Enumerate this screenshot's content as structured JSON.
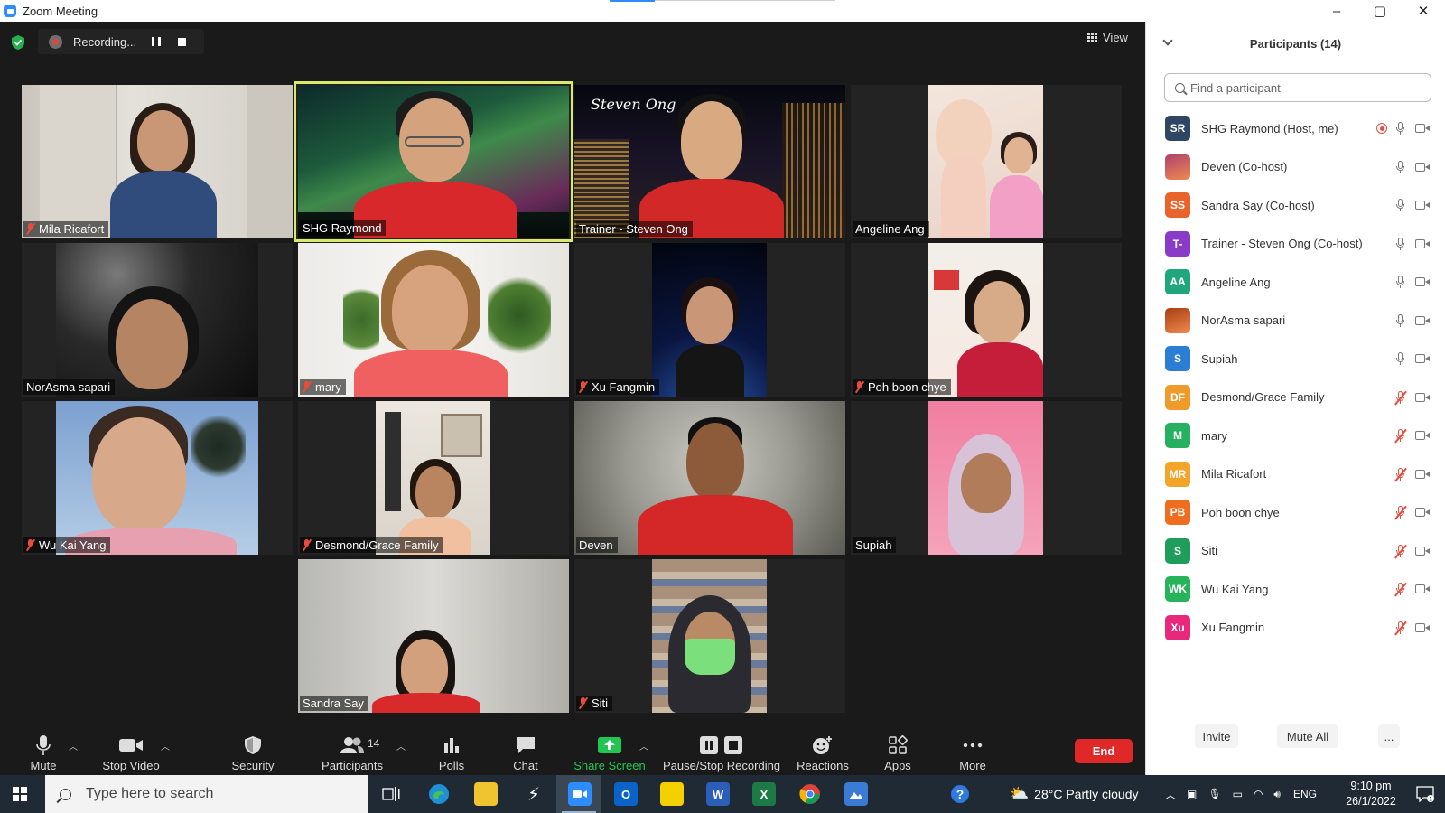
{
  "window": {
    "title": "Zoom Meeting",
    "controls": [
      "–",
      "▢",
      "✕"
    ]
  },
  "recording": {
    "status": "Recording..."
  },
  "view": {
    "label": "View"
  },
  "tiles": [
    {
      "name": "Mila Ricafort",
      "muted": true,
      "active": false
    },
    {
      "name": "SHG Raymond",
      "muted": false,
      "active": true
    },
    {
      "name": "Trainer - Steven Ong",
      "muted": false,
      "active": false,
      "bg_text": "Steven Ong"
    },
    {
      "name": "Angeline Ang",
      "muted": false,
      "active": false
    },
    {
      "name": "NorAsma sapari",
      "muted": false,
      "active": false
    },
    {
      "name": "mary",
      "muted": true,
      "active": false
    },
    {
      "name": "Xu Fangmin",
      "muted": true,
      "active": false
    },
    {
      "name": "Poh boon chye",
      "muted": true,
      "active": false
    },
    {
      "name": "Wu Kai Yang",
      "muted": true,
      "active": false
    },
    {
      "name": "Desmond/Grace Family",
      "muted": true,
      "active": false
    },
    {
      "name": "Deven",
      "muted": false,
      "active": false
    },
    {
      "name": "Supiah",
      "muted": false,
      "active": false
    },
    {
      "name": "Sandra Say",
      "muted": false,
      "active": false
    },
    {
      "name": "Siti",
      "muted": true,
      "active": false
    }
  ],
  "toolbar": {
    "mute": "Mute",
    "stop_video": "Stop Video",
    "security": "Security",
    "participants": "Participants",
    "participants_count": "14",
    "polls": "Polls",
    "chat": "Chat",
    "share_screen": "Share Screen",
    "pause_stop_recording": "Pause/Stop Recording",
    "reactions": "Reactions",
    "apps": "Apps",
    "more": "More",
    "end": "End"
  },
  "panel": {
    "title": "Participants (14)",
    "search_placeholder": "Find a participant",
    "participants": [
      {
        "initials": "SR",
        "name": "SHG Raymond (Host, me)",
        "color": "#2f4763",
        "muted": false,
        "recording": true
      },
      {
        "initials": "",
        "name": "Deven (Co-host)",
        "color": "#b0416e",
        "muted": false,
        "recording": false
      },
      {
        "initials": "SS",
        "name": "Sandra Say (Co-host)",
        "color": "#e9642a",
        "muted": false,
        "recording": false
      },
      {
        "initials": "T-",
        "name": "Trainer - Steven Ong (Co-host)",
        "color": "#8a3cc8",
        "muted": false,
        "recording": false
      },
      {
        "initials": "AA",
        "name": "Angeline Ang",
        "color": "#1fa67a",
        "muted": false,
        "recording": false
      },
      {
        "initials": "",
        "name": "NorAsma sapari",
        "color": "#a83e10",
        "muted": false,
        "recording": false
      },
      {
        "initials": "S",
        "name": "Supiah",
        "color": "#2a7fd4",
        "muted": false,
        "recording": false
      },
      {
        "initials": "DF",
        "name": "Desmond/Grace Family",
        "color": "#f09a2a",
        "muted": true,
        "recording": false
      },
      {
        "initials": "M",
        "name": "mary",
        "color": "#25b15f",
        "muted": true,
        "recording": false
      },
      {
        "initials": "MR",
        "name": "Mila Ricafort",
        "color": "#f3a52a",
        "muted": true,
        "recording": false
      },
      {
        "initials": "PB",
        "name": "Poh boon chye",
        "color": "#ef6d1f",
        "muted": true,
        "recording": false
      },
      {
        "initials": "S",
        "name": "Siti",
        "color": "#1e9e5a",
        "muted": true,
        "recording": false
      },
      {
        "initials": "WK",
        "name": "Wu Kai Yang",
        "color": "#26b35a",
        "muted": true,
        "recording": false
      },
      {
        "initials": "Xu",
        "name": "Xu Fangmin",
        "color": "#e8287a",
        "muted": true,
        "recording": false
      }
    ],
    "invite": "Invite",
    "mute_all": "Mute All",
    "more": "..."
  },
  "taskbar": {
    "search_text": "Type here to search",
    "weather": "28°C  Partly cloudy",
    "language": "ENG",
    "time": "9:10 pm",
    "date": "26/1/2022"
  }
}
